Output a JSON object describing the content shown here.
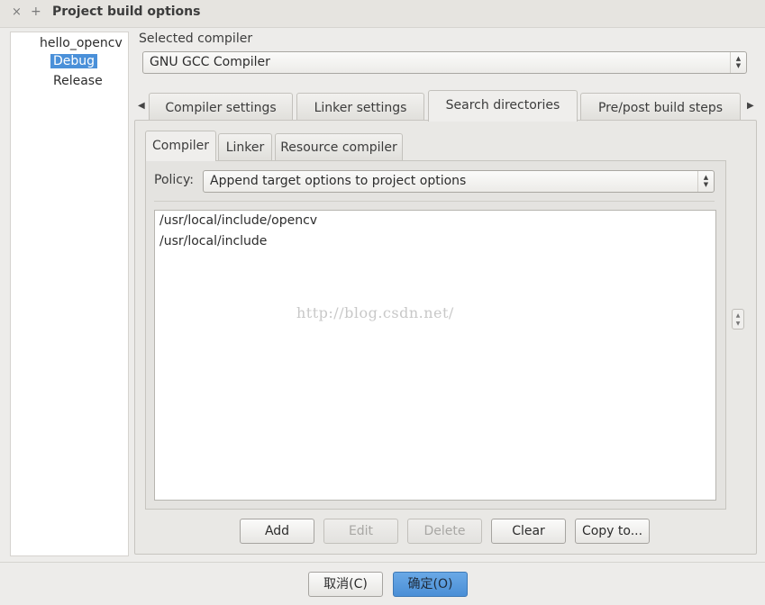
{
  "window": {
    "title": "Project build options",
    "close_glyph": "×",
    "plus_glyph": "+"
  },
  "tree": {
    "items": [
      "hello_opencv",
      "Debug",
      "Release"
    ],
    "selected": "Debug"
  },
  "compiler": {
    "label": "Selected compiler",
    "value": "GNU GCC Compiler"
  },
  "tabs": [
    "Compiler settings",
    "Linker settings",
    "Search directories",
    "Pre/post build steps"
  ],
  "active_tab": "Search directories",
  "subtabs": [
    "Compiler",
    "Linker",
    "Resource compiler"
  ],
  "active_subtab": "Compiler",
  "policy": {
    "label": "Policy:",
    "value": "Append target options to project options"
  },
  "directories": [
    "/usr/local/include/opencv",
    "/usr/local/include"
  ],
  "watermark": "http://blog.csdn.net/",
  "actions": {
    "add": "Add",
    "edit": "Edit",
    "delete": "Delete",
    "clear": "Clear",
    "copy_to": "Copy to..."
  },
  "dialog": {
    "cancel": "取消(C)",
    "ok": "确定(O)"
  },
  "colors": {
    "selection": "#4a90d9",
    "primary_button": "#5a9de0"
  }
}
